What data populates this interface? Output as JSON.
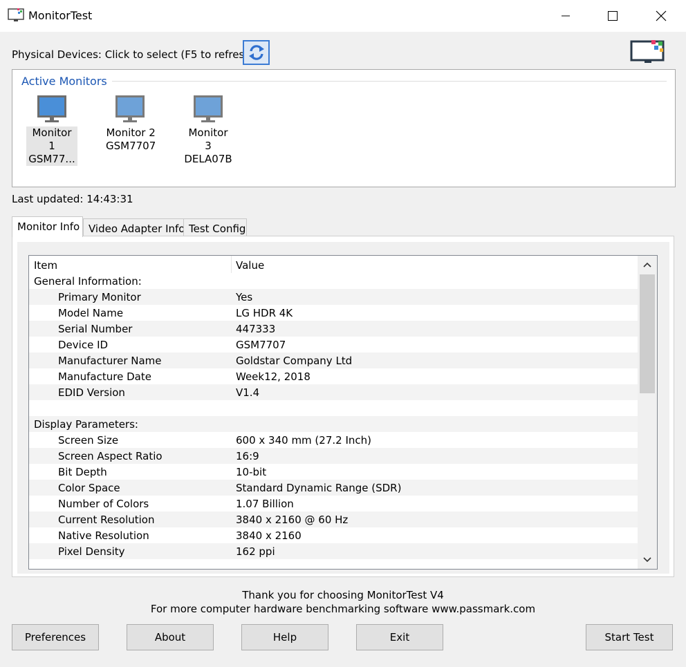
{
  "window": {
    "title": "MonitorTest",
    "icon": "monitortest-app-icon",
    "controls": [
      "minimize-icon",
      "maximize-icon",
      "close-icon"
    ]
  },
  "devices": {
    "label": "Physical Devices: Click to select (F5 to refresh)",
    "refresh_icon": "refresh-icon",
    "group_title": "Active Monitors",
    "monitors": [
      {
        "name": "Monitor 1",
        "id": "GSM77...",
        "selected": true
      },
      {
        "name": "Monitor 2",
        "id": "GSM7707",
        "selected": false
      },
      {
        "name": "Monitor 3",
        "id": "DELA07B",
        "selected": false
      }
    ]
  },
  "status": {
    "last_updated": "Last updated:  14:43:31"
  },
  "tabs": [
    {
      "label": "Monitor Info",
      "active": true
    },
    {
      "label": "Video Adapter Info",
      "active": false
    },
    {
      "label": "Test Config",
      "active": false
    }
  ],
  "table": {
    "columns": [
      "Item",
      "Value"
    ],
    "rows": [
      {
        "item": "General Information:",
        "value": "",
        "section": true
      },
      {
        "item": "Primary Monitor",
        "value": "Yes"
      },
      {
        "item": "Model Name",
        "value": "LG HDR 4K"
      },
      {
        "item": "Serial Number",
        "value": "447333"
      },
      {
        "item": "Device ID",
        "value": "GSM7707"
      },
      {
        "item": "Manufacturer Name",
        "value": "Goldstar Company Ltd"
      },
      {
        "item": "Manufacture Date",
        "value": "Week12, 2018"
      },
      {
        "item": "EDID Version",
        "value": "V1.4"
      },
      {
        "item": "",
        "value": "",
        "blank": true
      },
      {
        "item": "Display Parameters:",
        "value": "",
        "section": true
      },
      {
        "item": "Screen Size",
        "value": "600 x 340 mm (27.2 Inch)"
      },
      {
        "item": "Screen Aspect Ratio",
        "value": "16:9"
      },
      {
        "item": "Bit Depth",
        "value": "10-bit"
      },
      {
        "item": "Color Space",
        "value": "Standard Dynamic Range (SDR)"
      },
      {
        "item": "Number of Colors",
        "value": "1.07 Billion"
      },
      {
        "item": "Current Resolution",
        "value": "3840 x 2160 @ 60 Hz"
      },
      {
        "item": "Native Resolution",
        "value": "3840 x 2160"
      },
      {
        "item": "Pixel Density",
        "value": "162 ppi"
      }
    ]
  },
  "footer": {
    "line1": "Thank you for choosing MonitorTest V4",
    "line2": "For more computer hardware benchmarking software www.passmark.com"
  },
  "buttons": {
    "preferences": "Preferences",
    "about": "About",
    "help": "Help",
    "exit": "Exit",
    "start_test": "Start Test"
  },
  "colors": {
    "accent": "#1b56b3",
    "monitor_screen": "#4a8fd8",
    "row_shade": "#f3f3f3"
  }
}
